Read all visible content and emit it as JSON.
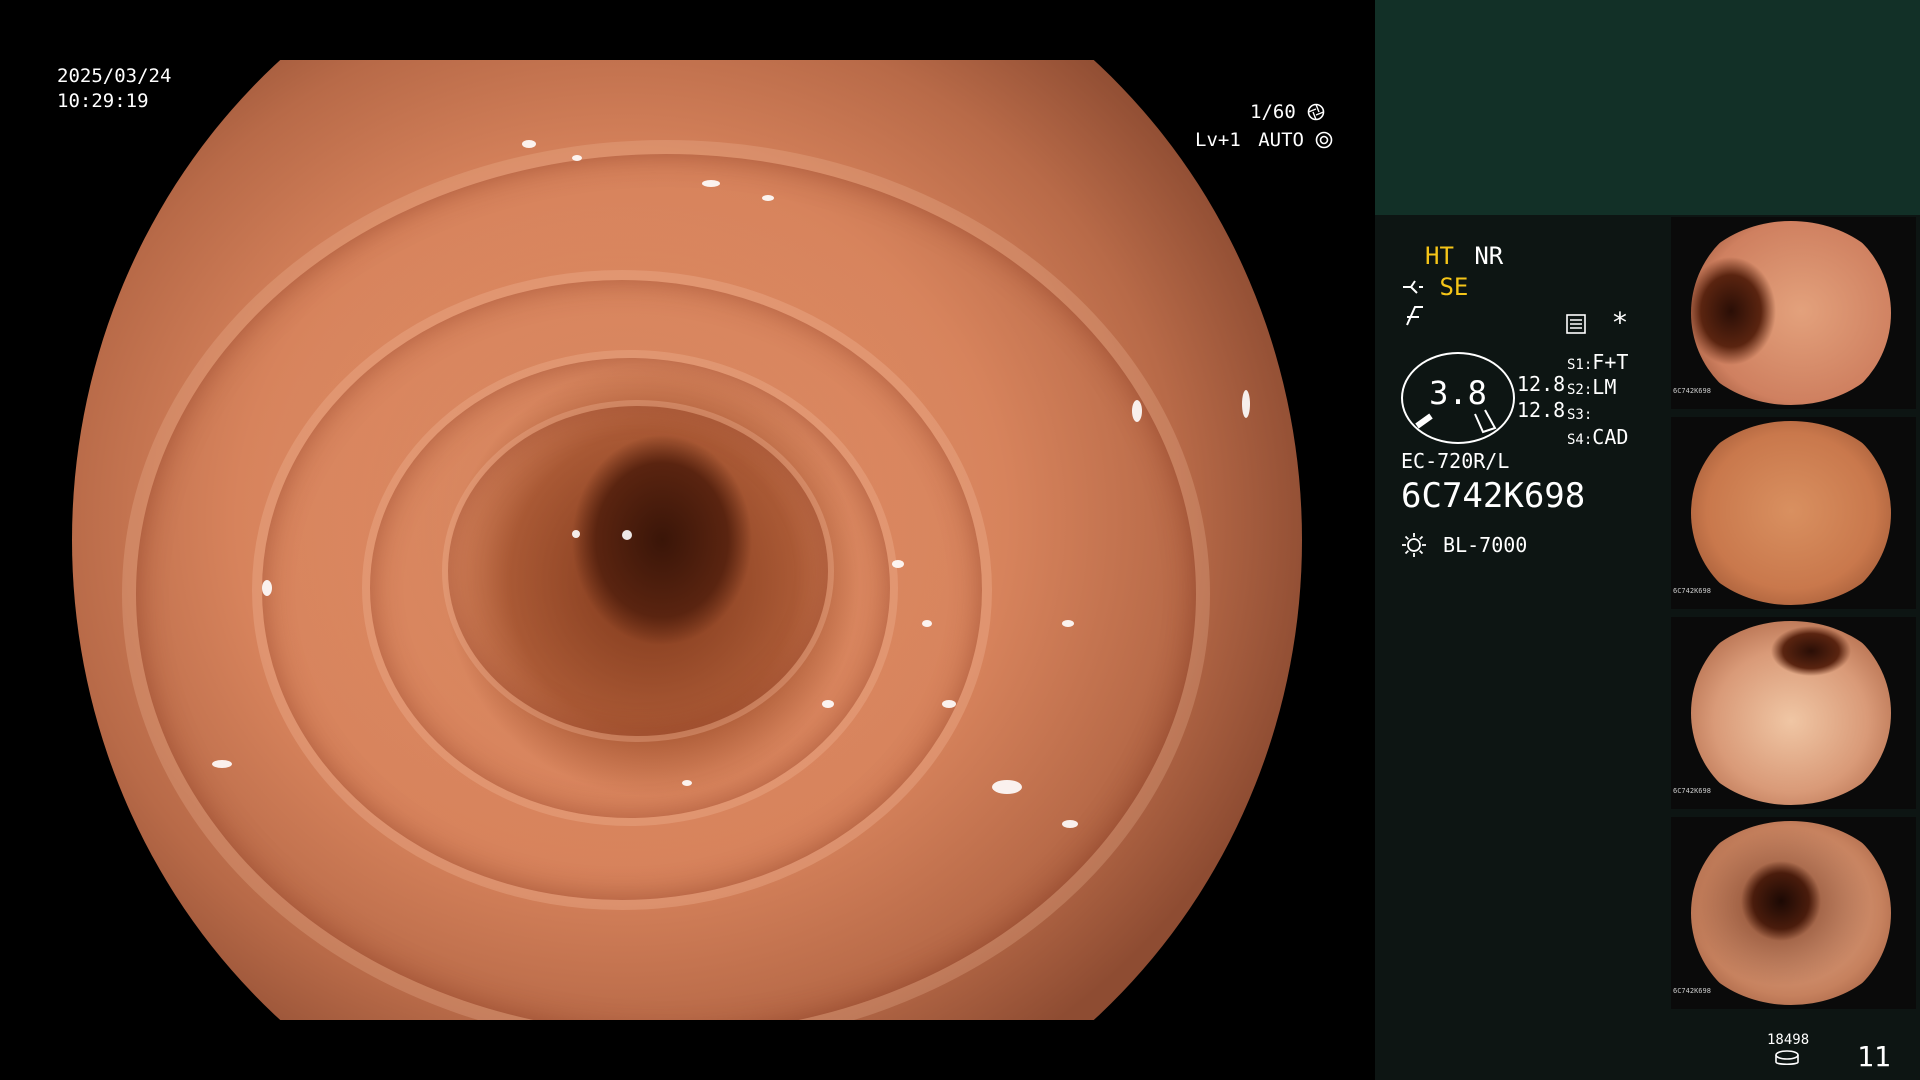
{
  "overlay": {
    "date": "2025/03/24",
    "time": "10:29:19",
    "shutter": "1/60",
    "shutter_icon": "aperture-icon",
    "level": "Lv+1",
    "mode": "AUTO",
    "mode_icon": "auto-iris-icon"
  },
  "status": {
    "ht": "HT",
    "nr": "NR",
    "se": "SE",
    "se_icon": "bent-arrow-icon",
    "slash_icon": "hook-symbol-icon",
    "menu_icon": "settings-panel-icon",
    "star": "*"
  },
  "gauge": {
    "value": "3.8",
    "upper": "12.8",
    "lower": "12.8"
  },
  "switches": [
    {
      "label": "S1:",
      "value": "F+T"
    },
    {
      "label": "S2:",
      "value": "LM"
    },
    {
      "label": "S3:",
      "value": ""
    },
    {
      "label": "S4:",
      "value": "CAD"
    }
  ],
  "scope": {
    "model": "EC-720R/L",
    "serial": "6C742K698",
    "light_source": "BL-7000",
    "light_icon": "sun-icon"
  },
  "thumbnails": [
    {
      "serial": "6C742K698"
    },
    {
      "serial": "6C742K698"
    },
    {
      "serial": "6C742K698"
    },
    {
      "serial": "6C742K698"
    }
  ],
  "footer": {
    "storage_count": "18498",
    "storage_icon": "storage-disk-icon",
    "capture_count": "11"
  },
  "colors": {
    "accent_yellow": "#f5c518",
    "panel_top": "#123027",
    "panel_bg": "#0d1513"
  }
}
